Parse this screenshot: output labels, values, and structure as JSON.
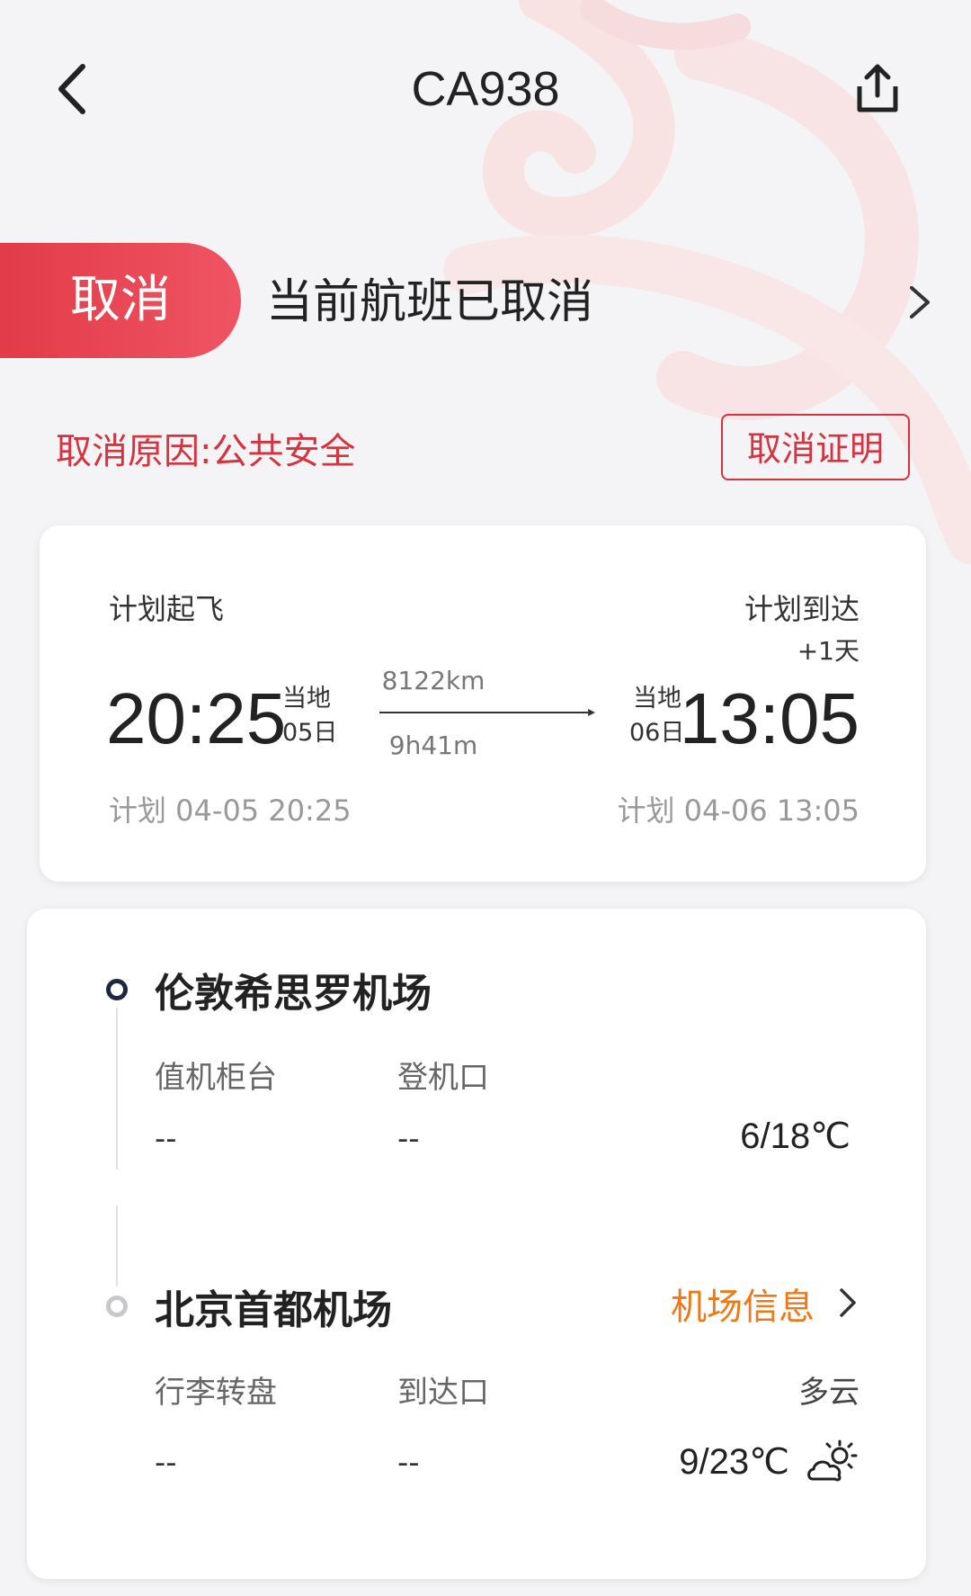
{
  "header": {
    "title": "CA938",
    "back_icon": "chevron-left-icon",
    "share_icon": "share-icon"
  },
  "status": {
    "badge": "取消",
    "message": "当前航班已取消",
    "reason": "取消原因:公共安全",
    "certificate_button": "取消证明",
    "badge_color": "#e23b49"
  },
  "flight": {
    "departure": {
      "plan_label": "计划起飞",
      "time": "20:25",
      "local_label": "当地",
      "day": "05日",
      "scheduled": "计划 04-05 20:25"
    },
    "arrival": {
      "plan_label": "计划到达",
      "plus_day": "+1天",
      "time": "13:05",
      "local_label": "当地",
      "day": "06日",
      "scheduled": "计划 04-06 13:05"
    },
    "distance": "8122km",
    "duration": "9h41m"
  },
  "airports": {
    "departure": {
      "name": "伦敦希思罗机场",
      "col1_label": "值机柜台",
      "col1_value": "--",
      "col2_label": "登机口",
      "col2_value": "--",
      "temperature": "6/18℃"
    },
    "arrival": {
      "name": "北京首都机场",
      "info_link": "机场信息",
      "col1_label": "行李转盘",
      "col1_value": "--",
      "col2_label": "到达口",
      "col2_value": "--",
      "weather": "多云",
      "temperature": "9/23℃",
      "weather_icon": "partly-cloudy-icon"
    }
  },
  "colors": {
    "accent_red": "#d4333f",
    "link_orange": "#ec7a1a"
  }
}
